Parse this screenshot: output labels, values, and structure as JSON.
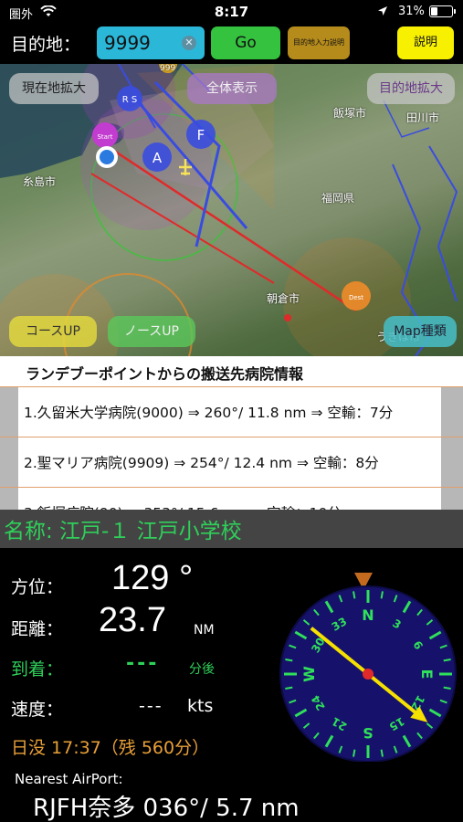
{
  "status": {
    "carrier": "圏外",
    "time": "8:17",
    "battery": "31%"
  },
  "topbar": {
    "dest_label": "目的地：",
    "dest_value": "9999",
    "go_label": "Go",
    "dest_help_label": "目的地入力説明",
    "help_label": "説明"
  },
  "map": {
    "buttons": {
      "zoom_here": "現在地拡大",
      "show_all": "全体表示",
      "zoom_dest": "目的地拡大",
      "course_up": "コースUP",
      "north_up": "ノースUP",
      "map_type": "Map種類"
    },
    "places": [
      "糸島市",
      "飯塚市",
      "田川市",
      "福岡県",
      "朝倉市",
      "うきは市",
      "999"
    ],
    "markers": {
      "start": "Start",
      "dest": "Dest",
      "a": "A",
      "f": "F",
      "rs": "R S"
    }
  },
  "hospital": {
    "title": "ランデブーポイントからの搬送先病院情報",
    "rows": [
      "1.久留米大学病院(9000) ⇒ 260°/ 11.8 nm ⇒ 空輸：7分",
      "2.聖マリア病院(9909) ⇒ 254°/ 12.4 nm ⇒ 空輸：8分",
      "3.飯塚病院(90) ⇒ 353°/ 15.6 nm ⇒ 空輸：10分"
    ]
  },
  "location_name": "名称: 江戸-１ 江戸小学校",
  "info": {
    "heading_label": "方位：",
    "heading_value": "129 °",
    "distance_label": "距離：",
    "distance_value": "23.7",
    "distance_unit": "NM",
    "arrival_label": "到着：",
    "arrival_value": "---",
    "arrival_unit": "分後",
    "speed_label": "速度：",
    "speed_value": "---",
    "speed_unit": "kts",
    "sunset": "日没 17:37（残 560分）",
    "nearest_label": "Nearest AirPort:",
    "nearest_value": "RJFH奈多  036°/ 5.7 nm"
  },
  "compass": {
    "heading_deg": 129,
    "cardinals": [
      "N",
      "E",
      "S",
      "W"
    ],
    "numbers": [
      "3",
      "6",
      "12",
      "15",
      "21",
      "24",
      "30",
      "33"
    ]
  }
}
